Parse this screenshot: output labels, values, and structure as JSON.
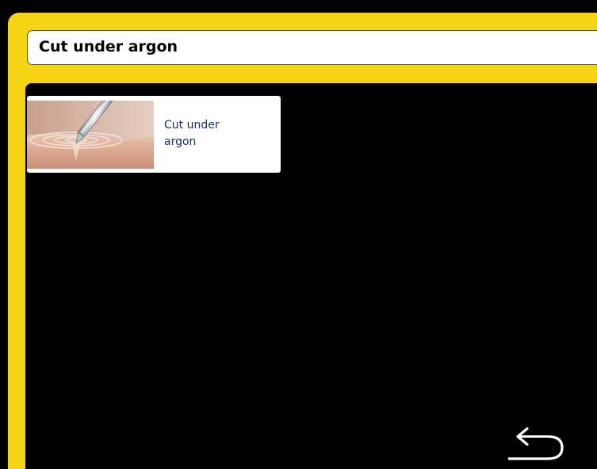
{
  "header": {
    "title": "Cut under argon"
  },
  "modes": [
    {
      "label": "Cut under\nargon",
      "icon": "electrode-tissue-cut-icon"
    }
  ],
  "navigation": {
    "back_icon": "return-arrow-icon"
  },
  "colors": {
    "frame_yellow": "#F5D415",
    "background": "#000000",
    "tile_background": "#FFFFFF",
    "label_text": "#1A2B5A",
    "title_text": "#000000"
  }
}
